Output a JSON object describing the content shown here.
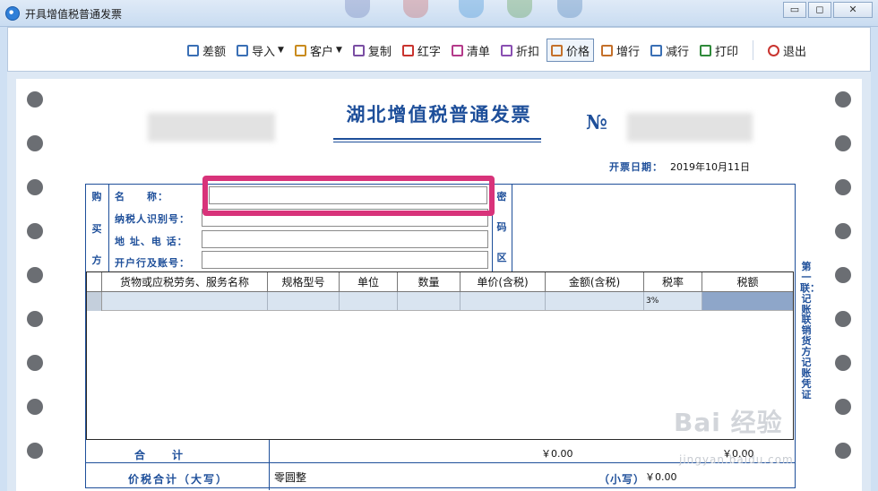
{
  "window": {
    "title": "开具增值税普通发票",
    "min": "▭",
    "max": "◻",
    "close": "✕"
  },
  "toolbar": {
    "items": [
      {
        "label": "差额",
        "icon": "calculator-icon",
        "color": "#3a6fb5"
      },
      {
        "label": "导入",
        "icon": "import-icon",
        "color": "#3a6fb5",
        "dropdown": true
      },
      {
        "label": "客户",
        "icon": "customer-icon",
        "color": "#c98b1d",
        "dropdown": true
      },
      {
        "label": "复制",
        "icon": "copy-icon",
        "color": "#7a4ea3"
      },
      {
        "label": "红字",
        "icon": "red-invoice-icon",
        "color": "#c9342f"
      },
      {
        "label": "清单",
        "icon": "list-icon",
        "color": "#b43a8a"
      },
      {
        "label": "折扣",
        "icon": "discount-icon",
        "color": "#8a4fb2"
      },
      {
        "label": "价格",
        "icon": "price-icon",
        "color": "#c4702a",
        "active": true
      },
      {
        "label": "增行",
        "icon": "add-row-icon",
        "color": "#c4702a"
      },
      {
        "label": "减行",
        "icon": "remove-row-icon",
        "color": "#3a6fb5"
      },
      {
        "label": "打印",
        "icon": "print-icon",
        "color": "#2f8a3a"
      }
    ],
    "exit": {
      "label": "退出",
      "icon": "power-icon",
      "color": "#c9342f"
    }
  },
  "invoice": {
    "title": "湖北增值税普通发票",
    "no_mark": "№",
    "date_label": "开票日期：",
    "date": "2019年10月11日",
    "buyer_label": [
      "购",
      "买",
      "方"
    ],
    "fields": [
      {
        "label": "名　　称：",
        "value": ""
      },
      {
        "label": "纳税人识别号：",
        "value": ""
      },
      {
        "label": "地 址、电 话：",
        "value": ""
      },
      {
        "label": "开户行及账号：",
        "value": ""
      }
    ],
    "cipher_label": [
      "密",
      "码",
      "区"
    ],
    "columns": [
      "货物或应税劳务、服务名称",
      "规格型号",
      "单位",
      "数量",
      "单价(含税)",
      "金额(含税)",
      "税率",
      "税额"
    ],
    "row": {
      "tax_rate": "3%"
    },
    "total_label": "合　　计",
    "total_amount": "￥0.00",
    "total_tax": "￥0.00",
    "tax_total_label": "价税合计（大写）",
    "tax_total_words": "零圆整",
    "small_label": "（小写）",
    "small_value": "￥0.00",
    "copy_label": "第一联：记账联 销货方记账凭证"
  },
  "watermark": {
    "brand": "Bai 经验",
    "url": "jingyan.baidu.com"
  }
}
